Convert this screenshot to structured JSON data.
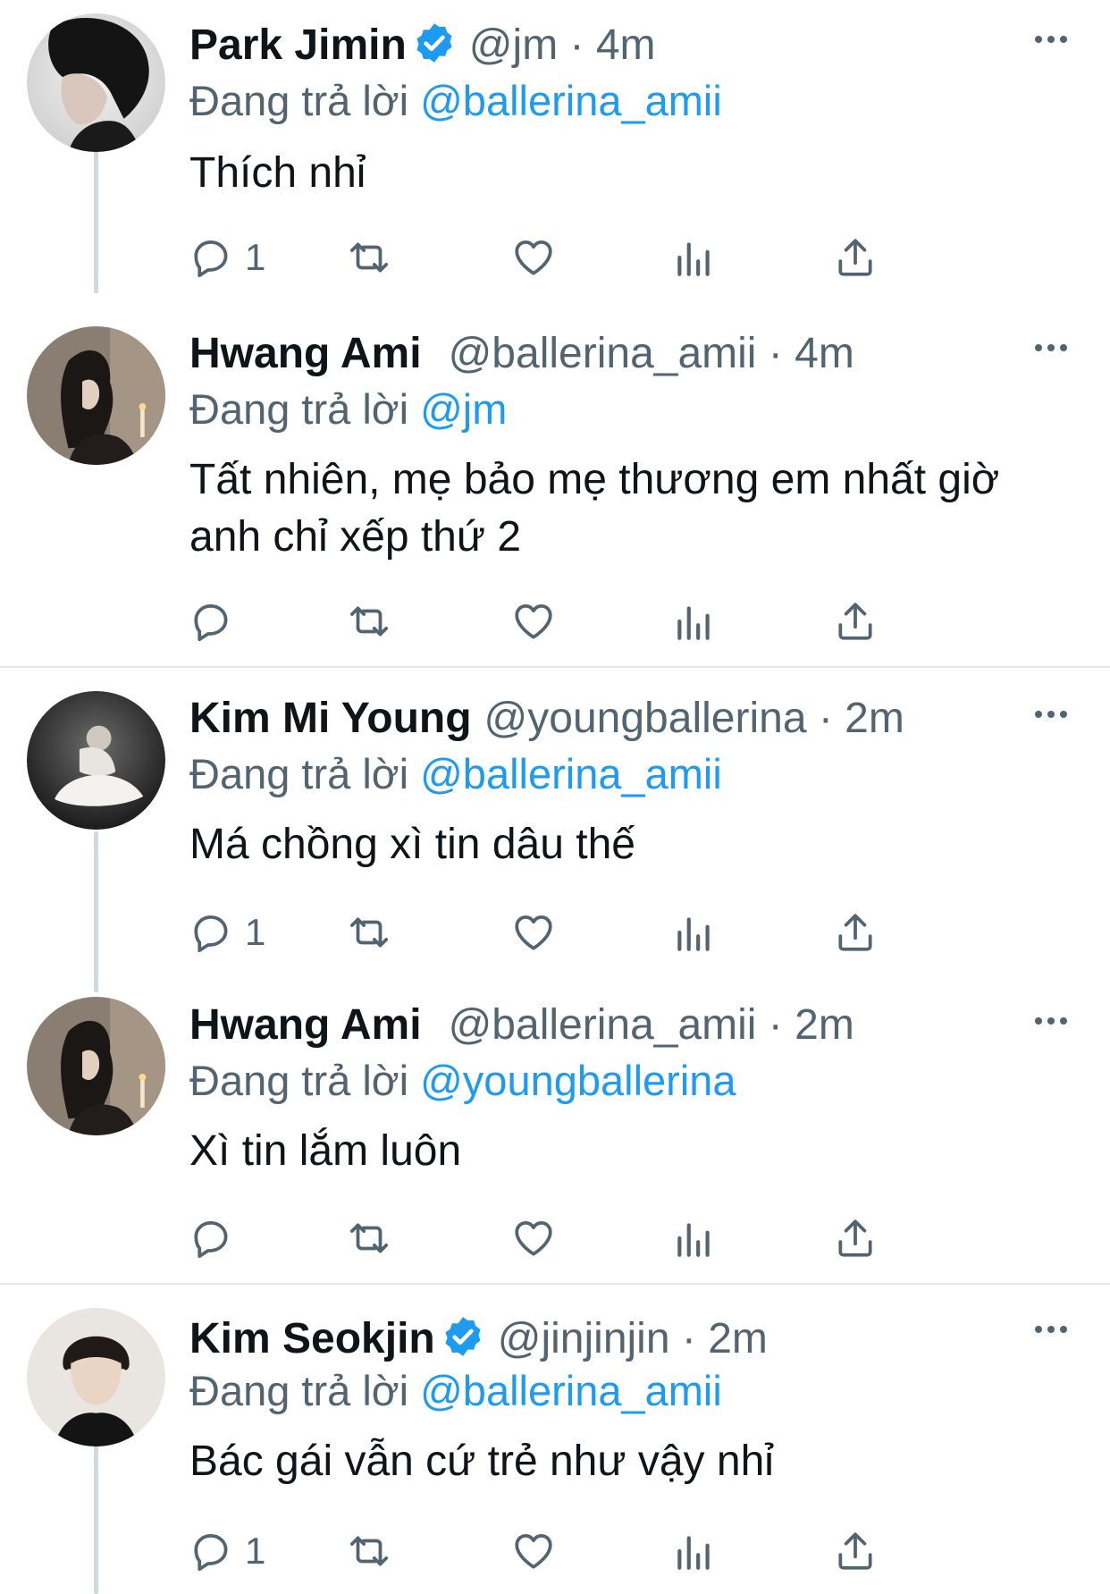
{
  "tweets": [
    {
      "name": "Park Jimin",
      "verified": true,
      "handle": "@jm",
      "meta": "@jm · 4m",
      "reply_prefix": "Đang trả lời",
      "reply_to": "@ballerina_amii",
      "text": "Thích nhỉ",
      "reply_count": "1"
    },
    {
      "name": "Hwang Ami",
      "verified": false,
      "meta": "@ballerina_amii · 4m",
      "reply_prefix": "Đang trả lời",
      "reply_to": "@jm",
      "text": "Tất nhiên, mẹ bảo mẹ thương em nhất giờ anh chỉ xếp thứ 2",
      "reply_count": ""
    },
    {
      "name": "Kim Mi Young",
      "verified": false,
      "meta": "@youngballerina · 2m",
      "reply_prefix": "Đang trả lời",
      "reply_to": "@ballerina_amii",
      "text": "Má chồng xì tin dâu thế",
      "reply_count": "1"
    },
    {
      "name": "Hwang Ami",
      "verified": false,
      "meta": "@ballerina_amii · 2m",
      "reply_prefix": "Đang trả lời",
      "reply_to": "@youngballerina",
      "text": "Xì tin lắm luôn",
      "reply_count": ""
    },
    {
      "name": "Kim Seokjin",
      "verified": true,
      "meta": "@jinjinjin · 2m",
      "reply_prefix": "Đang trả lời",
      "reply_to": "@ballerina_amii",
      "text": "Bác gái vẫn cứ trẻ như vậy nhỉ",
      "reply_count": "1"
    }
  ],
  "icons": {
    "reply": "reply-icon",
    "retweet": "retweet-icon",
    "like": "heart-icon",
    "views": "views-icon",
    "share": "share-icon",
    "more": "more-icon",
    "verified": "verified-badge-icon"
  },
  "colors": {
    "link": "#1d9bf0",
    "secondary_text": "#536471",
    "primary_text": "#0f1419",
    "thread_line": "#cfd9de"
  }
}
